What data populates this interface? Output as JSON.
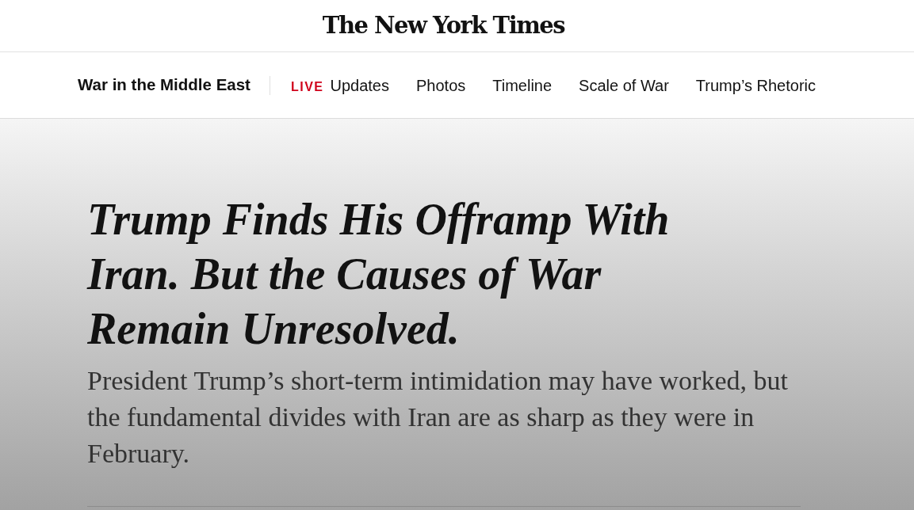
{
  "masthead": {
    "logo": "The New York Times"
  },
  "section_nav": {
    "title": "War in the Middle East",
    "links": [
      {
        "kind": "live",
        "badge": "LIVE",
        "label": "Updates"
      },
      {
        "kind": "link",
        "label": "Photos"
      },
      {
        "kind": "link",
        "label": "Timeline"
      },
      {
        "kind": "link",
        "label": "Scale of War"
      },
      {
        "kind": "link",
        "label": "Trump’s Rhetoric"
      }
    ]
  },
  "article": {
    "headline": "Trump Finds His Offramp With Iran. But the Causes of War Remain Unresolved.",
    "summary": "President Trump’s short-term intimidation may have worked, but the fundamental divides with Iran are as sharp as they were in February."
  }
}
